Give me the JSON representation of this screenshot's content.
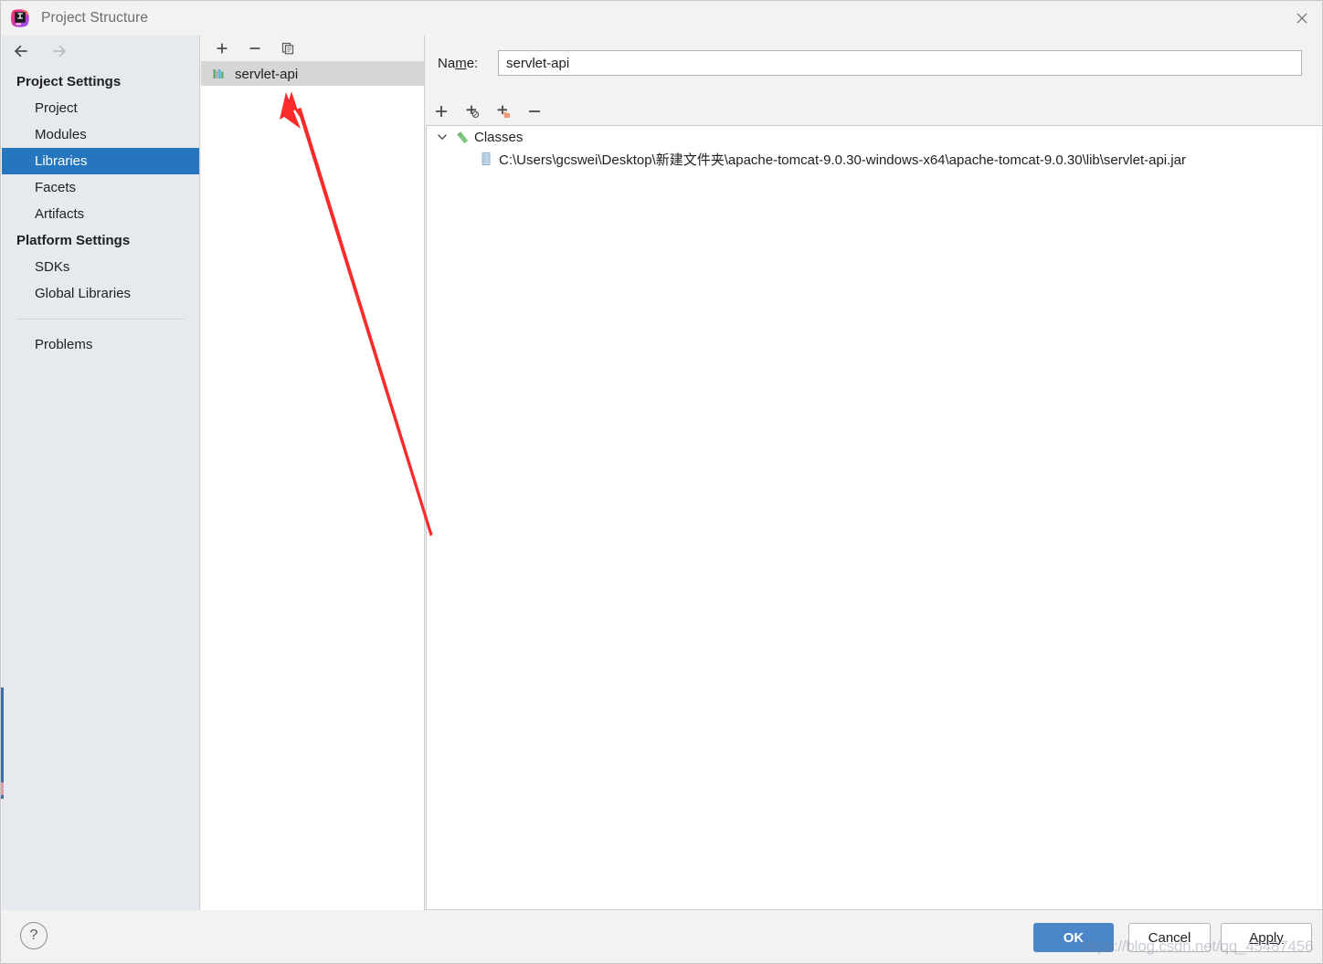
{
  "window": {
    "title": "Project Structure",
    "app_icon": "intellij-idea-logo",
    "close_icon": "close-icon"
  },
  "sidebar": {
    "nav": {
      "back_icon": "arrow-left-icon",
      "forward_icon": "arrow-right-icon"
    },
    "groups": [
      {
        "title": "Project Settings",
        "items": [
          {
            "label": "Project",
            "selected": false
          },
          {
            "label": "Modules",
            "selected": false
          },
          {
            "label": "Libraries",
            "selected": true
          },
          {
            "label": "Facets",
            "selected": false
          },
          {
            "label": "Artifacts",
            "selected": false
          }
        ]
      },
      {
        "title": "Platform Settings",
        "items": [
          {
            "label": "SDKs",
            "selected": false
          },
          {
            "label": "Global Libraries",
            "selected": false
          }
        ]
      }
    ],
    "problems": {
      "label": "Problems"
    },
    "selected_color": "#2675bf",
    "background": "#e6eaee"
  },
  "libraries_panel": {
    "toolbar": [
      {
        "name": "add-library-button",
        "icon": "plus-icon"
      },
      {
        "name": "remove-library-button",
        "icon": "minus-icon"
      },
      {
        "name": "copy-library-button",
        "icon": "copy-icon"
      }
    ],
    "items": [
      {
        "label": "servlet-api",
        "icon": "library-icon",
        "selected": true
      }
    ]
  },
  "details": {
    "name_label_pre": "Na",
    "name_label_mnemonic": "m",
    "name_label_post": "e:",
    "name_value": "servlet-api",
    "name_placeholder": "",
    "toolbar": [
      {
        "name": "add-classes-button",
        "icon": "plus-icon"
      },
      {
        "name": "add-sources-button",
        "icon": "plus-sources-icon"
      },
      {
        "name": "add-javadoc-button",
        "icon": "plus-folder-icon"
      },
      {
        "name": "remove-entry-button",
        "icon": "minus-icon"
      }
    ],
    "tree": {
      "root": {
        "label": "Classes",
        "icon": "classes-arrow-icon",
        "expanded": true,
        "chevron": "chevron-down-icon"
      },
      "children": [
        {
          "label": "C:\\Users\\gcswei\\Desktop\\新建文件夹\\apache-tomcat-9.0.30-windows-x64\\apache-tomcat-9.0.30\\lib\\servlet-api.jar",
          "icon": "jar-file-icon"
        }
      ]
    }
  },
  "footer": {
    "help_label": "?",
    "ok_label": "OK",
    "cancel_label": "Cancel",
    "apply_label": "Apply",
    "ok_color": "#4a86c8"
  },
  "watermark": {
    "text": "https://blog.csdn.net/qq_45487456"
  },
  "annotation": {
    "arrow_color": "#fb2b2b",
    "description": "red-arrow-pointing-to-library-item"
  }
}
